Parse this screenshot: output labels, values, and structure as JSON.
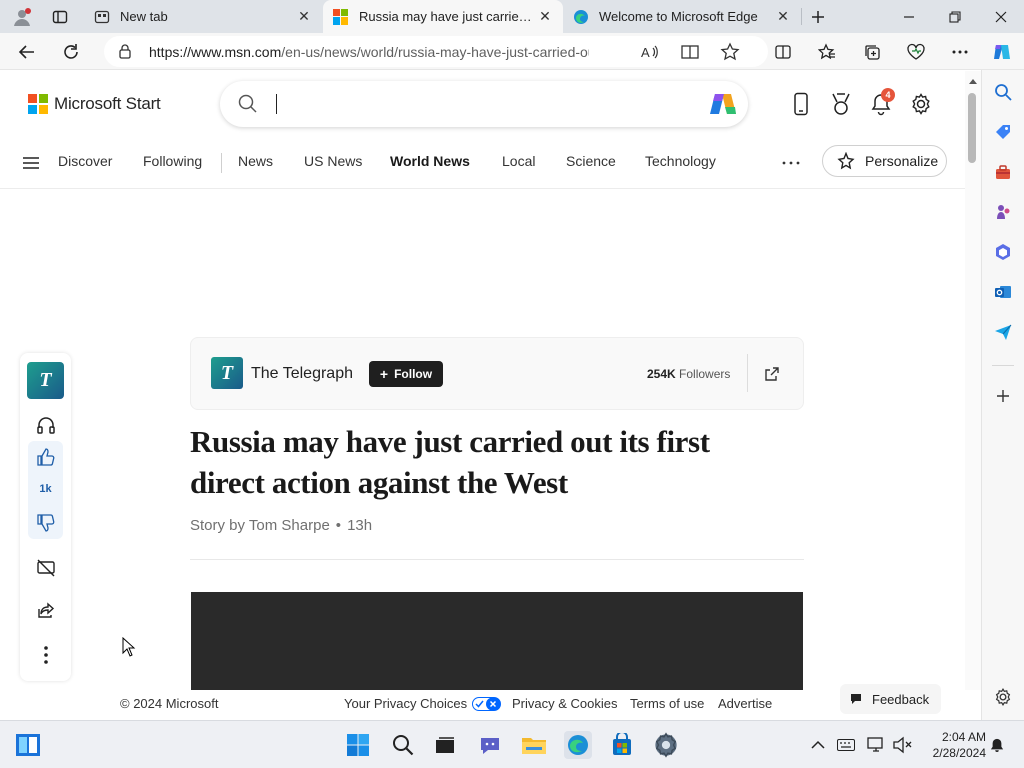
{
  "browser": {
    "tabs": [
      {
        "title": "New tab"
      },
      {
        "title": "Russia may have just carried out its first direct action against the West"
      },
      {
        "title": "Welcome to Microsoft Edge"
      }
    ],
    "url_host": "https://www.msn.com",
    "url_path": "/en-us/news/world/russia-may-have-just-carried-out-i..."
  },
  "site": {
    "brand": "Microsoft Start",
    "notifications_count": "4",
    "nav": [
      "Discover",
      "Following",
      "News",
      "US News",
      "World News",
      "Local",
      "Science",
      "Technology"
    ],
    "nav_selected": "World News",
    "personalize": "Personalize"
  },
  "article": {
    "publisher": "The Telegraph",
    "publisher_logo_letter": "T",
    "follow_label": "Follow",
    "followers_count": "254K",
    "followers_label": "Followers",
    "title": "Russia may have just carried out its first direct action against the West",
    "byline": "Story by Tom Sharpe",
    "byline_separator": "•",
    "age": "13h",
    "likes": "1k"
  },
  "footer": {
    "copyright": "© 2024 Microsoft",
    "privacy_choices": "Your Privacy Choices",
    "privacy_cookies": "Privacy & Cookies",
    "terms": "Terms of use",
    "advertise": "Advertise",
    "feedback": "Feedback"
  },
  "taskbar": {
    "time": "2:04 AM",
    "date": "2/28/2024"
  },
  "colors": {
    "ms_red": "#f25022",
    "ms_green": "#7fba00",
    "ms_blue": "#00a4ef",
    "ms_yellow": "#ffb900",
    "badge": "#e5553b"
  }
}
